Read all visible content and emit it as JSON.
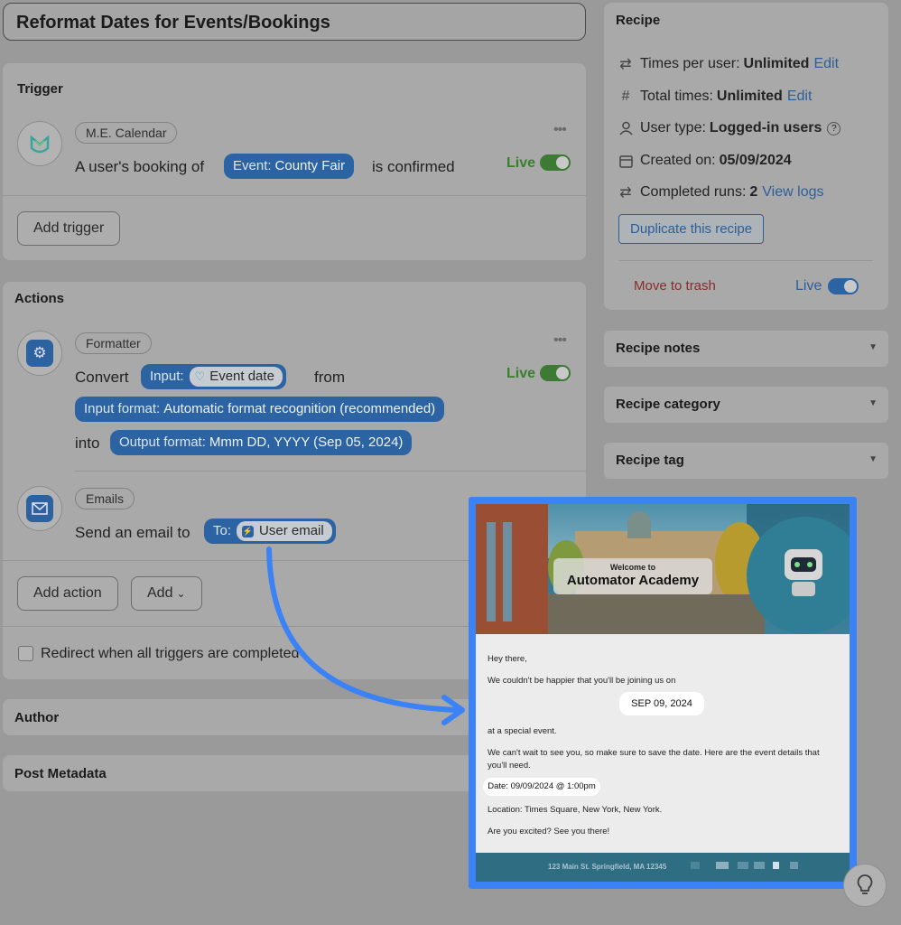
{
  "page_title": "Reformat Dates for Events/Bookings",
  "trigger": {
    "heading": "Trigger",
    "integration": "M.E. Calendar",
    "sentence_prefix": "A user's booking of",
    "token_label": "Event:",
    "token_value": "County Fair",
    "sentence_suffix": "is confirmed",
    "status": "Live",
    "add_button": "Add trigger"
  },
  "actions": {
    "heading": "Actions",
    "formatter": {
      "integration": "Formatter",
      "verb": "Convert",
      "input_label": "Input:",
      "input_value": "Event date",
      "from": "from",
      "input_format_label": "Input format:",
      "input_format_value": "Automatic format recognition (recommended)",
      "into": "into",
      "output_format_label": "Output format:",
      "output_format_value": "Mmm DD, YYYY (Sep 05, 2024)",
      "status": "Live"
    },
    "emails": {
      "integration": "Emails",
      "sentence": "Send an email to",
      "to_label": "To:",
      "to_value": "User email"
    },
    "add_action": "Add action",
    "add": "Add",
    "redirect_label": "Redirect when all triggers are completed"
  },
  "author_heading": "Author",
  "post_metadata_heading": "Post Metadata",
  "recipe": {
    "heading": "Recipe",
    "times_per_user_label": "Times per user:",
    "times_per_user_value": "Unlimited",
    "total_times_label": "Total times:",
    "total_times_value": "Unlimited",
    "edit": "Edit",
    "user_type_label": "User type:",
    "user_type_value": "Logged-in users",
    "created_label": "Created on:",
    "created_value": "05/09/2024",
    "completed_label": "Completed runs:",
    "completed_value": "2",
    "view_logs": "View logs",
    "duplicate": "Duplicate this recipe",
    "trash": "Move to trash",
    "status": "Live"
  },
  "side_sections": [
    "Recipe notes",
    "Recipe category",
    "Recipe tag"
  ],
  "email_preview": {
    "welcome": "Welcome to",
    "academy": "Automator Academy",
    "greeting": "Hey there,",
    "line1": "We couldn't be happier that you'll be joining us on",
    "date_pill": "SEP 09, 2024",
    "line2": "at a special event.",
    "line3a": "We can't wait to see you, so make sure to save the date. Here are the event details that",
    "line3b": "you'll need.",
    "date_line": "Date: 09/09/2024 @ 1:00pm",
    "location": "Location: Times Square, New York, New York.",
    "closing": "Are you excited? See you there!",
    "footer": "123 Main St.  Springfield, MA 12345"
  },
  "colors": {
    "accent": "#3b82f6",
    "token": "#2c63a3",
    "live_green": "#3d7a33"
  }
}
